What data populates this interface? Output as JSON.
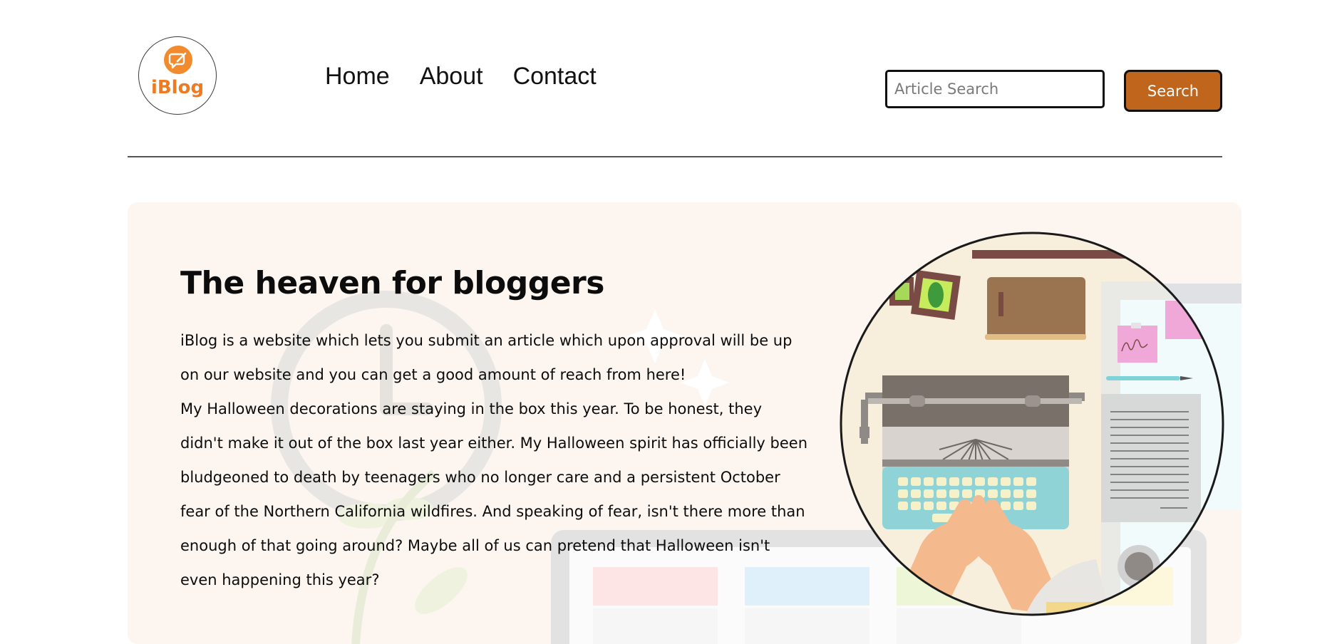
{
  "logo": {
    "text": "iBlog",
    "icon": "chat-bubble-icon"
  },
  "nav": {
    "items": [
      "Home",
      "About",
      "Contact"
    ]
  },
  "search": {
    "placeholder": "Article Search",
    "button_label": "Search"
  },
  "hero": {
    "title": "The heaven for bloggers",
    "paragraphs": [
      "iBlog is a website which lets you submit an article which upon approval will be up on our website and you can get a good amount of reach from here!",
      "My Halloween decorations are staying in the box this year. To be honest, they didn't make it out of the box last year either. My Halloween spirit has officially been bludgeoned to death by teenagers who no longer care and a persistent October fear of the Northern California wildfires. And speaking of fear, isn't there more than enough of that going around? Maybe all of us can pretend that Halloween isn't even happening this year?"
    ]
  },
  "colors": {
    "accent": "#bf661c",
    "logo": "#f07a1f",
    "hero_bg": "#fdf6f0"
  }
}
